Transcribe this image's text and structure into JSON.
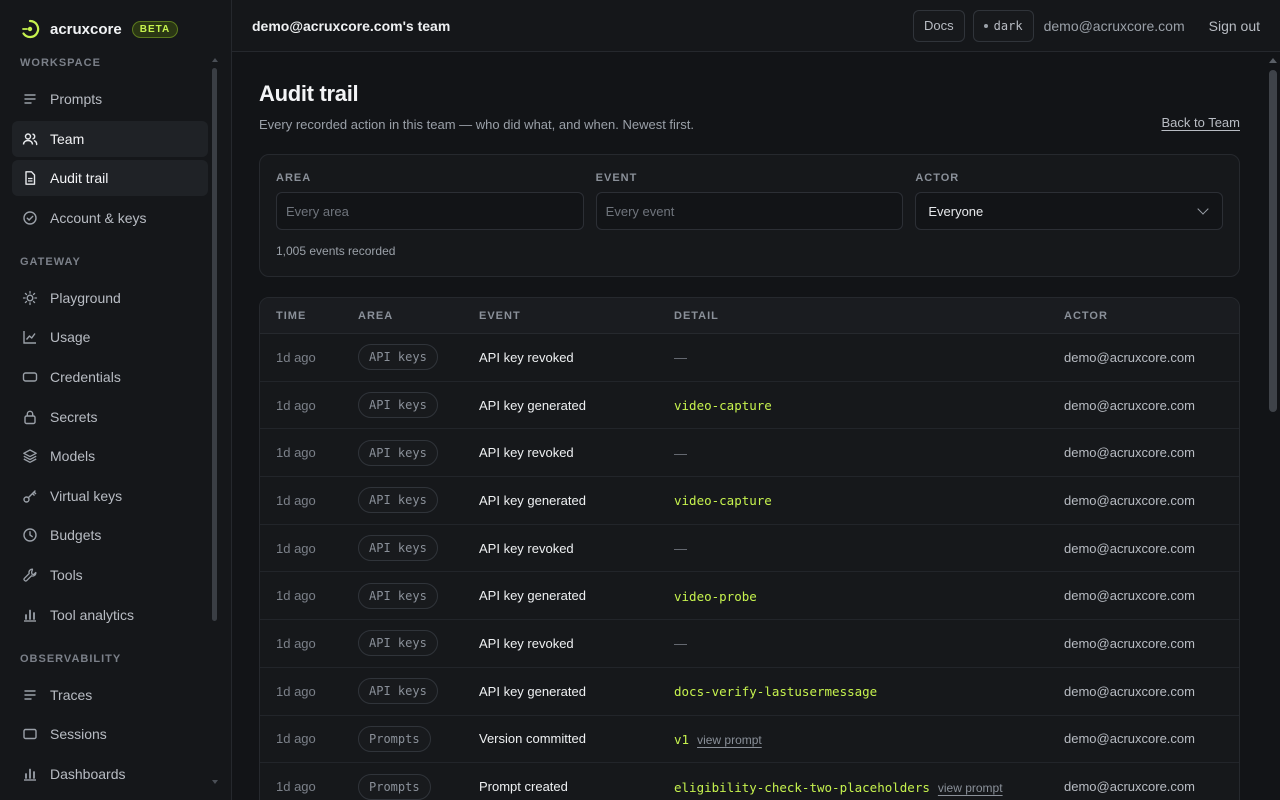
{
  "brand": {
    "name": "acruxcore",
    "badge": "BETA"
  },
  "sidebar": {
    "sections": [
      {
        "label": "WORKSPACE",
        "items": [
          {
            "label": "Prompts",
            "icon": "list-icon",
            "active": false
          },
          {
            "label": "Team",
            "icon": "users-icon",
            "active": true
          },
          {
            "label": "Audit trail",
            "icon": "document-icon",
            "active": true
          },
          {
            "label": "Account & keys",
            "icon": "check-circle-icon",
            "active": false
          }
        ]
      },
      {
        "label": "GATEWAY",
        "items": [
          {
            "label": "Playground",
            "icon": "sun-icon",
            "active": false
          },
          {
            "label": "Usage",
            "icon": "line-chart-icon",
            "active": false
          },
          {
            "label": "Credentials",
            "icon": "card-icon",
            "active": false
          },
          {
            "label": "Secrets",
            "icon": "lock-icon",
            "active": false
          },
          {
            "label": "Models",
            "icon": "layers-icon",
            "active": false
          },
          {
            "label": "Virtual keys",
            "icon": "key-icon",
            "active": false
          },
          {
            "label": "Budgets",
            "icon": "clock-icon",
            "active": false
          },
          {
            "label": "Tools",
            "icon": "wrench-icon",
            "active": false
          },
          {
            "label": "Tool analytics",
            "icon": "bar-chart-icon",
            "active": false
          }
        ]
      },
      {
        "label": "OBSERVABILITY",
        "items": [
          {
            "label": "Traces",
            "icon": "list-icon",
            "active": false
          },
          {
            "label": "Sessions",
            "icon": "window-icon",
            "active": false
          },
          {
            "label": "Dashboards",
            "icon": "bar-chart-icon",
            "active": false
          }
        ]
      }
    ]
  },
  "topbar": {
    "team_title": "demo@acruxcore.com's team",
    "docs_label": "Docs",
    "theme_label": "dark",
    "email": "demo@acruxcore.com",
    "signout_label": "Sign out"
  },
  "page": {
    "title": "Audit trail",
    "subtitle": "Every recorded action in this team — who did what, and when. Newest first.",
    "back_link": "Back to Team"
  },
  "filters": {
    "area": {
      "label": "AREA",
      "placeholder": "Every area"
    },
    "event": {
      "label": "EVENT",
      "placeholder": "Every event"
    },
    "actor": {
      "label": "ACTOR",
      "value": "Everyone"
    },
    "count_text": "1,005 events recorded"
  },
  "table": {
    "columns": [
      "TIME",
      "AREA",
      "EVENT",
      "DETAIL",
      "ACTOR"
    ],
    "rows": [
      {
        "time": "1d ago",
        "area": "API keys",
        "event": "API key revoked",
        "detail": "—",
        "detail_kind": "dash",
        "link": "",
        "actor": "demo@acruxcore.com"
      },
      {
        "time": "1d ago",
        "area": "API keys",
        "event": "API key generated",
        "detail": "video-capture",
        "detail_kind": "code",
        "link": "",
        "actor": "demo@acruxcore.com"
      },
      {
        "time": "1d ago",
        "area": "API keys",
        "event": "API key revoked",
        "detail": "—",
        "detail_kind": "dash",
        "link": "",
        "actor": "demo@acruxcore.com"
      },
      {
        "time": "1d ago",
        "area": "API keys",
        "event": "API key generated",
        "detail": "video-capture",
        "detail_kind": "code",
        "link": "",
        "actor": "demo@acruxcore.com"
      },
      {
        "time": "1d ago",
        "area": "API keys",
        "event": "API key revoked",
        "detail": "—",
        "detail_kind": "dash",
        "link": "",
        "actor": "demo@acruxcore.com"
      },
      {
        "time": "1d ago",
        "area": "API keys",
        "event": "API key generated",
        "detail": "video-probe",
        "detail_kind": "code",
        "link": "",
        "actor": "demo@acruxcore.com"
      },
      {
        "time": "1d ago",
        "area": "API keys",
        "event": "API key revoked",
        "detail": "—",
        "detail_kind": "dash",
        "link": "",
        "actor": "demo@acruxcore.com"
      },
      {
        "time": "1d ago",
        "area": "API keys",
        "event": "API key generated",
        "detail": "docs-verify-lastusermessage",
        "detail_kind": "code",
        "link": "",
        "actor": "demo@acruxcore.com"
      },
      {
        "time": "1d ago",
        "area": "Prompts",
        "event": "Version committed",
        "detail": "v1",
        "detail_kind": "code",
        "link": "view prompt",
        "actor": "demo@acruxcore.com"
      },
      {
        "time": "1d ago",
        "area": "Prompts",
        "event": "Prompt created",
        "detail": "eligibility-check-two-placeholders",
        "detail_kind": "code",
        "link": "view prompt",
        "actor": "demo@acruxcore.com"
      }
    ]
  },
  "colors": {
    "accent": "#c6f24e",
    "background": "#121417",
    "surface": "#16181b"
  }
}
